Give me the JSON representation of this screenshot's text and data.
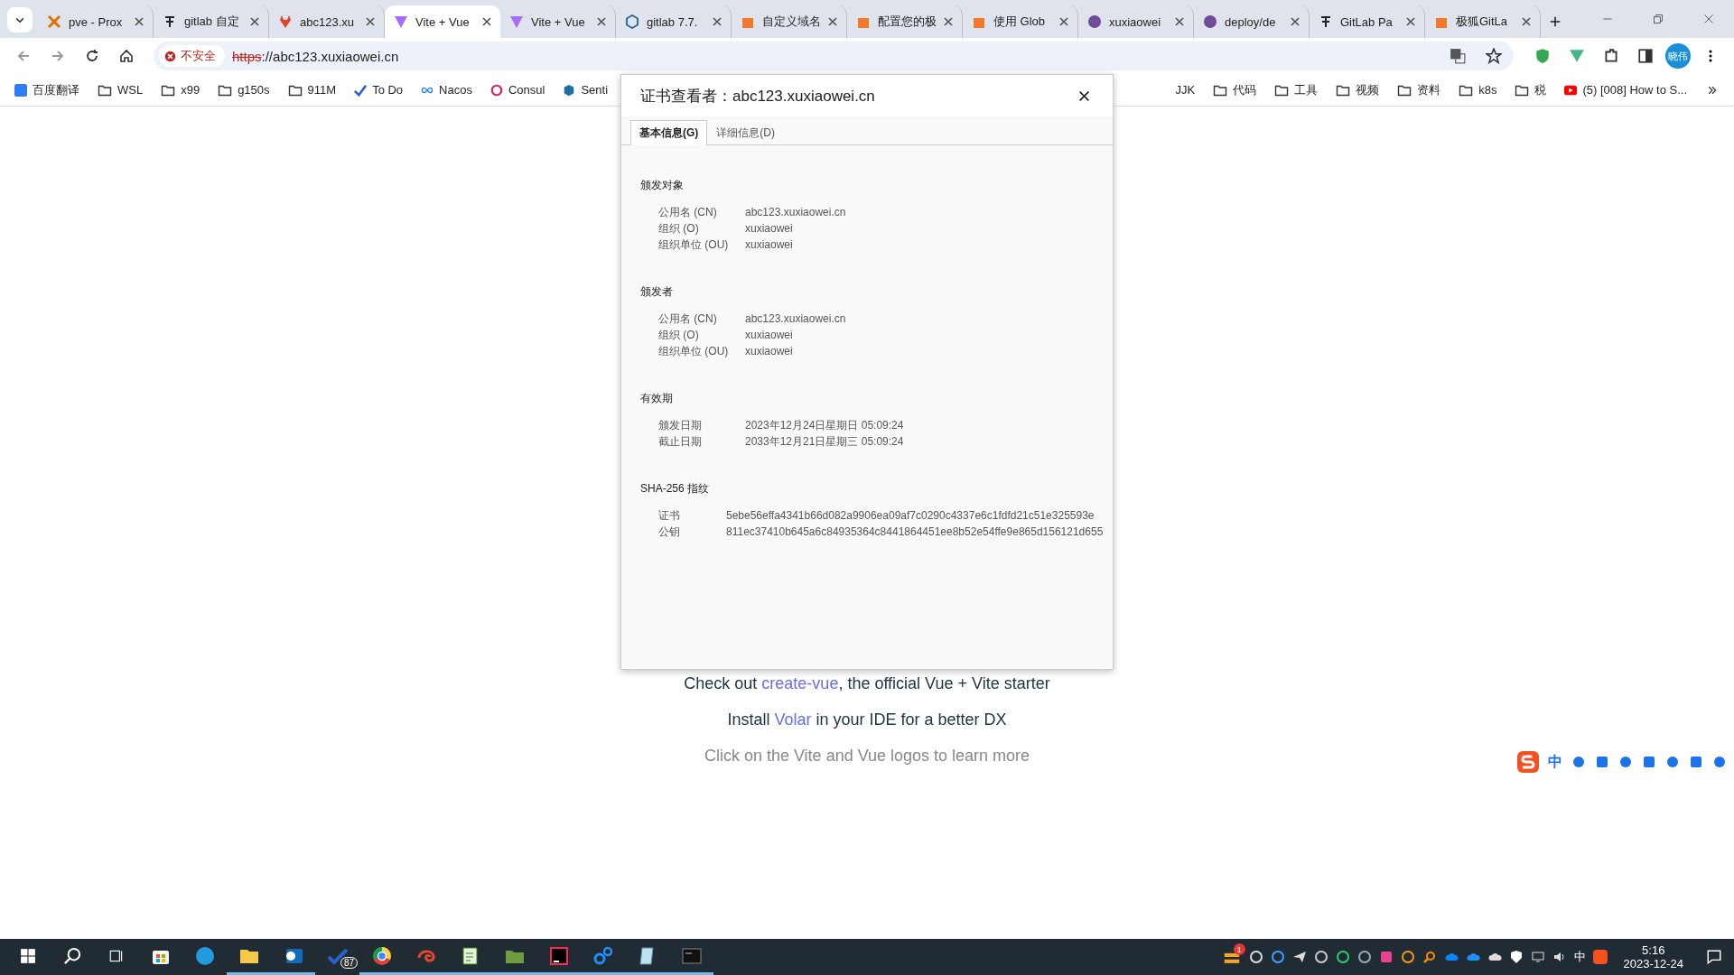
{
  "browser": {
    "tabs": [
      {
        "title": "pve - Prox",
        "selected": false
      },
      {
        "title": "gitlab 自定",
        "selected": false
      },
      {
        "title": "abc123.xu",
        "selected": false
      },
      {
        "title": "Vite + Vue",
        "selected": true
      },
      {
        "title": "Vite + Vue",
        "selected": false
      },
      {
        "title": "gitlab 7.7.",
        "selected": false
      },
      {
        "title": "自定义域名",
        "selected": false
      },
      {
        "title": "配置您的极",
        "selected": false
      },
      {
        "title": "使用 Glob",
        "selected": false
      },
      {
        "title": "xuxiaowei",
        "selected": false
      },
      {
        "title": "deploy/de",
        "selected": false
      },
      {
        "title": "GitLab Pa",
        "selected": false
      },
      {
        "title": "极狐GitLa",
        "selected": false
      }
    ],
    "security_label": "不安全",
    "url_scheme": "https",
    "url_rest": "://abc123.xuxiaowei.cn",
    "profile": "晓伟",
    "bookmarks_left": [
      "百度翻译",
      "WSL",
      "x99",
      "g150s",
      "911M",
      "To Do",
      "Nacos",
      "Consul",
      "Senti"
    ],
    "bookmarks_right": [
      "JJK",
      "代码",
      "工具",
      "视频",
      "资料",
      "k8s",
      "税",
      "(5) [008] How to S..."
    ]
  },
  "dialog": {
    "title": "证书查看者：abc123.xuxiaowei.cn",
    "tabs": [
      {
        "label": "基本信息(G)",
        "selected": true
      },
      {
        "label": "详细信息(D)",
        "selected": false
      }
    ],
    "sections": [
      {
        "heading": "颁发对象",
        "rows": [
          {
            "label": "公用名 (CN)",
            "value": "abc123.xuxiaowei.cn"
          },
          {
            "label": "组织 (O)",
            "value": "xuxiaowei"
          },
          {
            "label": "组织单位 (OU)",
            "value": "xuxiaowei"
          }
        ]
      },
      {
        "heading": "颁发者",
        "rows": [
          {
            "label": "公用名 (CN)",
            "value": "abc123.xuxiaowei.cn"
          },
          {
            "label": "组织 (O)",
            "value": "xuxiaowei"
          },
          {
            "label": "组织单位 (OU)",
            "value": "xuxiaowei"
          }
        ]
      },
      {
        "heading": "有效期",
        "rows": [
          {
            "label": "颁发日期",
            "value": "2023年12月24日星期日 05:09:24"
          },
          {
            "label": "截止日期",
            "value": "2033年12月21日星期三 05:09:24"
          }
        ]
      },
      {
        "heading": "SHA-256 指纹",
        "narrow": true,
        "rows": [
          {
            "label": "证书",
            "value": "5ebe56effa4341b66d082a9906ea09af7c0290c4337e6c1fdfd21c51e325593e"
          },
          {
            "label": "公钥",
            "value": "811ec37410b645a6c84935364c8441864451ee8b52e54ffe9e865d156121d655"
          }
        ]
      }
    ]
  },
  "page": {
    "lines": [
      {
        "before": "Check out ",
        "link": "create-vue",
        "after": ", the official Vue + Vite starter"
      },
      {
        "before": "Install ",
        "link": "Volar",
        "after": " in your IDE for a better DX"
      }
    ],
    "hint": "Click on the Vite and Vue logos to learn more"
  },
  "ime_toolbar": {
    "mode": "中"
  },
  "taskbar": {
    "todo_badge": "87",
    "tray_badge": "1",
    "input_mode": "中",
    "time": "5:16",
    "date": "2023-12-24"
  }
}
